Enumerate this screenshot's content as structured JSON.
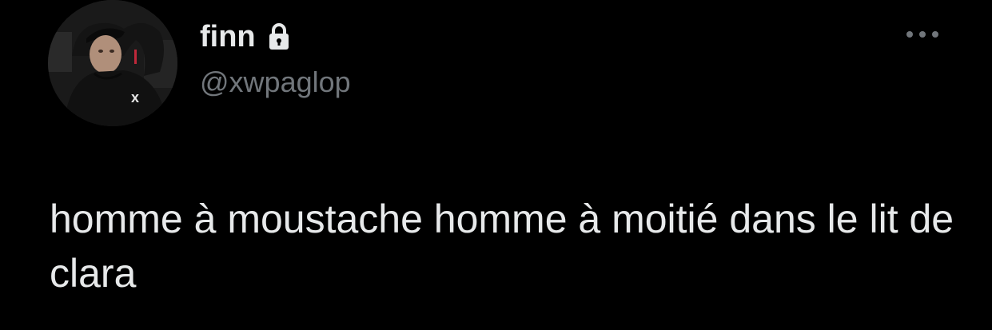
{
  "tweet": {
    "author": {
      "display_name": "finn",
      "handle": "@xwpaglop",
      "protected_icon": "lock-icon",
      "avatar_icon": "profile-photo"
    },
    "more_icon": "ellipsis-icon",
    "text": "homme à moustache homme à moitié dans le lit de clara"
  },
  "colors": {
    "background": "#000000",
    "primary_text": "#e7e9ea",
    "secondary_text": "#71767b"
  }
}
